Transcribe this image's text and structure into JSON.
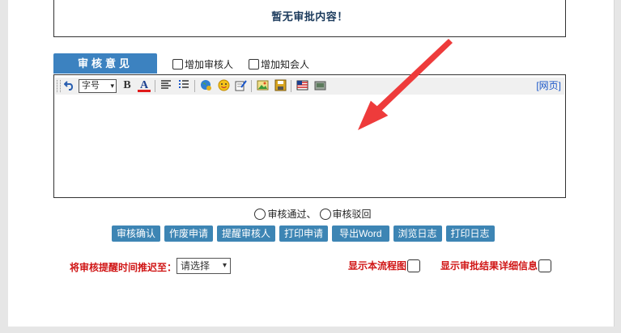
{
  "message": {
    "text": "暂无审批内容！"
  },
  "tab": {
    "label": "审核意见"
  },
  "checkboxes": {
    "add_reviewer": "增加审核人",
    "add_notify": "增加知会人"
  },
  "toolbar": {
    "font_size_label": "字号",
    "select_arrow": "▾",
    "bold_glyph": "B",
    "font_color_glyph": "A",
    "web_link": "[网页]",
    "icons": [
      "undo-icon",
      "bold-icon",
      "font-color-icon",
      "align-icon",
      "list-icon",
      "globe-icon",
      "smiley-icon",
      "edit-icon",
      "image-icon",
      "save-icon",
      "flag-icon",
      "database-icon"
    ]
  },
  "radios": {
    "approve": "审核通过、",
    "reject": "审核驳回"
  },
  "buttons": {
    "confirm": "审核确认",
    "void": "作废申请",
    "remind": "提醒审核人",
    "print_request": "打印申请",
    "export_word": "导出Word",
    "view_log": "浏览日志",
    "print_log": "打印日志"
  },
  "delay": {
    "label": "将审核提醒时间推迟至：",
    "selected": "请选择",
    "arrow": "▾"
  },
  "options": {
    "show_flowchart": "显示本流程图",
    "show_details": "显示审批结果详细信息"
  },
  "colors": {
    "tab_blue": "#3c82c0",
    "button_blue": "#3d85b4",
    "warning_red": "#d01616",
    "annotation_arrow": "#ee3b3b",
    "message_navy": "#1b3a5c",
    "link_blue": "#1a56c8"
  }
}
